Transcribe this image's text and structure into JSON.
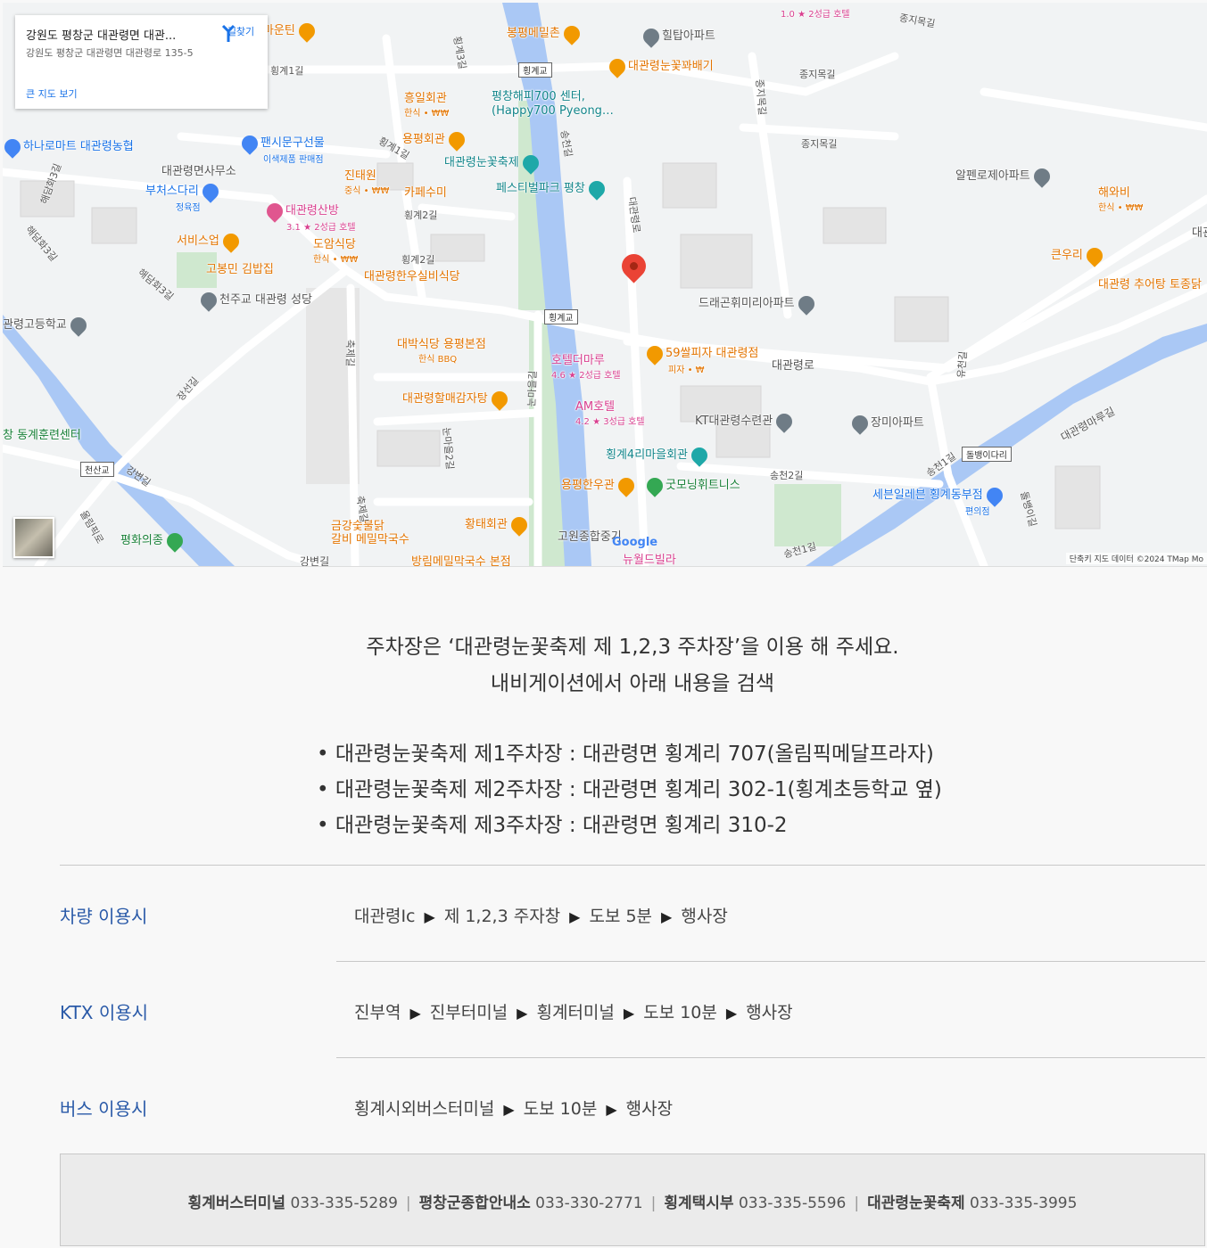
{
  "map": {
    "info_title": "강원도 평창군 대관령면 대관...",
    "info_address": "강원도 평창군 대관령면 대관령로 135-5",
    "larger_map_link": "큰 지도 보기",
    "directions_label": "길찾기",
    "attribution": "단축키   지도 데이터 ©2024 TMap Mo",
    "google_logo": "Google",
    "pois": [
      {
        "name": "커피마운틴",
        "sub": "",
        "color": "orange"
      },
      {
        "name": "봉평메밀촌",
        "sub": "",
        "color": "orange"
      },
      {
        "name": "힐탑아파트",
        "sub": "",
        "color": "gray"
      },
      {
        "name": "대관령눈꽃꽈배기",
        "sub": "",
        "color": "orange"
      },
      {
        "name": "흥일회관",
        "sub": "한식 • ₩₩",
        "color": "orange"
      },
      {
        "name": "평창해피700 센터,",
        "sub": "(Happy700 Pyeong…",
        "color": "teal"
      },
      {
        "name": "용평회관",
        "sub": "",
        "color": "orange"
      },
      {
        "name": "대관령눈꽃축제",
        "sub": "",
        "color": "teal"
      },
      {
        "name": "하나로마트 대관령농협",
        "sub": "",
        "color": "blue"
      },
      {
        "name": "팬시문구선물",
        "sub": "이색제품 판매점",
        "color": "blue"
      },
      {
        "name": "대관령면사무소",
        "sub": "",
        "color": "gray"
      },
      {
        "name": "진태원",
        "sub": "중식 • ₩₩",
        "color": "orange"
      },
      {
        "name": "카페수미",
        "sub": "",
        "color": "orange"
      },
      {
        "name": "페스티벌파크 평창",
        "sub": "",
        "color": "teal"
      },
      {
        "name": "부처스다리",
        "sub": "정육점",
        "color": "blue"
      },
      {
        "name": "대관령산방",
        "sub": "3.1 ★ 2성급 호텔",
        "color": "pink"
      },
      {
        "name": "서비스업",
        "sub": "",
        "color": "orange"
      },
      {
        "name": "도암식당",
        "sub": "한식 • ₩₩",
        "color": "orange"
      },
      {
        "name": "고봉민 김밥집",
        "sub": "",
        "color": "orange"
      },
      {
        "name": "대관령한우실비식당",
        "sub": "",
        "color": "orange"
      },
      {
        "name": "천주교 대관령 성당",
        "sub": "",
        "color": "gray"
      },
      {
        "name": "관령고등학교",
        "sub": "",
        "color": "gray"
      },
      {
        "name": "대박식당 용평본점",
        "sub": "한식 BBQ",
        "color": "orange"
      },
      {
        "name": "호텔더마루",
        "sub": "4.6 ★ 2성급 호텔",
        "color": "pink"
      },
      {
        "name": "59쌀피자 대관령점",
        "sub": "피자 • ₩",
        "color": "orange"
      },
      {
        "name": "드래곤휘미리아파트",
        "sub": "",
        "color": "gray"
      },
      {
        "name": "알펜로제아파트",
        "sub": "",
        "color": "gray"
      },
      {
        "name": "해와비",
        "sub": "한식 • ₩₩",
        "color": "orange"
      },
      {
        "name": "큰우리",
        "sub": "",
        "color": "orange"
      },
      {
        "name": "대관령 추어탕 토종닭",
        "sub": "",
        "color": "orange"
      },
      {
        "name": "대관령할매감자탕",
        "sub": "",
        "color": "orange"
      },
      {
        "name": "AM호텔",
        "sub": "4.2 ★ 3성급 호텔",
        "color": "pink"
      },
      {
        "name": "KT대관령수련관",
        "sub": "",
        "color": "gray"
      },
      {
        "name": "장미아파트",
        "sub": "",
        "color": "gray"
      },
      {
        "name": "창 동계훈련센터",
        "sub": "",
        "color": "green"
      },
      {
        "name": "횡계4리마을회관",
        "sub": "",
        "color": "teal"
      },
      {
        "name": "용평한우관",
        "sub": "",
        "color": "orange"
      },
      {
        "name": "굿모닝휘트니스",
        "sub": "",
        "color": "green"
      },
      {
        "name": "세븐일레븐 횡계동부점",
        "sub": "편의점",
        "color": "blue"
      },
      {
        "name": "황태회관",
        "sub": "",
        "color": "orange"
      },
      {
        "name": "금강숯불닭",
        "sub": "갈비 메밀막국수",
        "color": "orange"
      },
      {
        "name": "고원종합중기",
        "sub": "",
        "color": "gray"
      },
      {
        "name": "평화의종",
        "sub": "",
        "color": "green"
      },
      {
        "name": "뉴월드빌라",
        "sub": "",
        "color": "pink"
      },
      {
        "name": "방림메밀막국수 본점",
        "sub": "",
        "color": "orange"
      },
      {
        "name": "1.0 ★ 2성급 호텔",
        "sub": "",
        "color": "pink"
      }
    ],
    "streets": [
      "횡계1길",
      "횡계3길",
      "종지목길",
      "종지목길",
      "종지목길",
      "횡계1길",
      "송천길",
      "대관령로",
      "횡계2길",
      "횡계2길",
      "해담화3길",
      "해담화3길",
      "해담화3길",
      "대관령로",
      "축제길",
      "눈마을길",
      "눈마을2길",
      "장선길",
      "강변길",
      "강변길",
      "축제길",
      "올림픽로",
      "송천2길",
      "송천1길",
      "송천1길",
      "돌뱅이길",
      "대관령마루길",
      "유천길",
      "종지목길",
      "대관"
    ],
    "bridges": [
      "횡계교",
      "횡계교",
      "천산교",
      "돌뱅이다리"
    ]
  },
  "intro": {
    "line1": "주차장은 ‘대관령눈꽃축제 제 1,2,3 주차장’을 이용 해 주세요.",
    "line2": "내비게이션에서 아래 내용을 검색"
  },
  "parking": [
    "• 대관령눈꽃축제 제1주차장 : 대관령면 횡계리 707(올림픽메달프라자)",
    "• 대관령눈꽃축제 제2주차장 : 대관령면 횡계리 302-1(횡계초등학교 옆)",
    "• 대관령눈꽃축제 제3주차장 : 대관령면 횡계리 310-2"
  ],
  "routes": [
    {
      "label": "차량 이용시",
      "steps": [
        "대관령Ic",
        "제 1,2,3 주자창",
        "도보 5분",
        "행사장"
      ]
    },
    {
      "label": "KTX 이용시",
      "steps": [
        "진부역",
        "진부터미널",
        "횡계터미널",
        "도보 10분",
        "행사장"
      ]
    },
    {
      "label": "버스 이용시",
      "steps": [
        "횡계시외버스터미널",
        "도보 10분",
        "행사장"
      ]
    }
  ],
  "arrow_symbol": "▶",
  "contacts": [
    {
      "name": "횡계버스터미널",
      "phone": "033-335-5289"
    },
    {
      "name": "평창군종합안내소",
      "phone": "033-330-2771"
    },
    {
      "name": "횡계택시부",
      "phone": "033-335-5596"
    },
    {
      "name": "대관령눈꽃축제",
      "phone": "033-335-3995"
    }
  ],
  "colors": {
    "accent": "#2a5aa8",
    "river": "#aac8f5",
    "map_bg": "#f1f3f4",
    "marker": "#ea4335"
  }
}
